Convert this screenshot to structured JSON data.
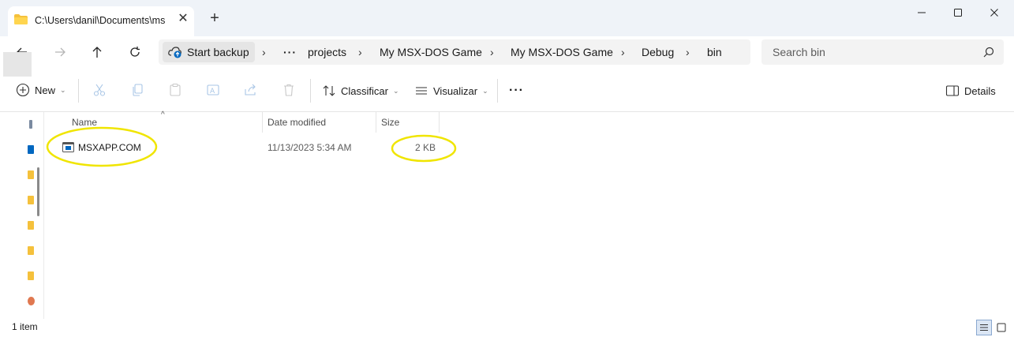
{
  "window": {
    "tab_title": "C:\\Users\\danil\\Documents\\ms",
    "tab_close": "✕",
    "new_tab": "+"
  },
  "nav": {
    "backup_label": "Start backup",
    "overflow": "···",
    "breadcrumbs": [
      "projects",
      "My MSX-DOS Game",
      "My MSX-DOS Game",
      "Debug",
      "bin"
    ],
    "separator": "›",
    "search_placeholder": "Search bin"
  },
  "commands": {
    "new_label": "New",
    "sort_label": "Classificar",
    "view_label": "Visualizar",
    "more": "···",
    "details_label": "Details",
    "chevron": "⌄"
  },
  "columns": {
    "name": "Name",
    "date": "Date modified",
    "size": "Size"
  },
  "files": [
    {
      "name": "MSXAPP.COM",
      "date": "11/13/2023 5:34 AM",
      "size": "2 KB"
    }
  ],
  "status": {
    "item_count": "1 item"
  },
  "colors": {
    "accent": "#0067c0",
    "folder": "#f5c13c",
    "highlight": "#f0e500"
  }
}
